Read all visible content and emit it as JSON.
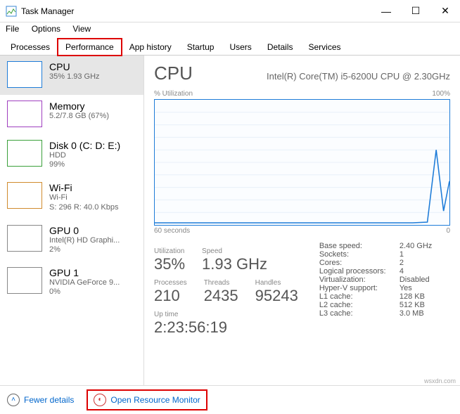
{
  "window": {
    "title": "Task Manager"
  },
  "menu": {
    "file": "File",
    "options": "Options",
    "view": "View"
  },
  "tabs": {
    "processes": "Processes",
    "performance": "Performance",
    "app_history": "App history",
    "startup": "Startup",
    "users": "Users",
    "details": "Details",
    "services": "Services"
  },
  "side": {
    "cpu": {
      "title": "CPU",
      "line1": "35%  1.93 GHz"
    },
    "mem": {
      "title": "Memory",
      "line1": "5.2/7.8 GB (67%)"
    },
    "disk": {
      "title": "Disk 0 (C: D: E:)",
      "line1": "HDD",
      "line2": "99%"
    },
    "wifi": {
      "title": "Wi-Fi",
      "line1": "Wi-Fi",
      "line2": "S: 296 R: 40.0 Kbps"
    },
    "gpu0": {
      "title": "GPU 0",
      "line1": "Intel(R) HD Graphi...",
      "line2": "2%"
    },
    "gpu1": {
      "title": "GPU 1",
      "line1": "NVIDIA GeForce 9...",
      "line2": "0%"
    }
  },
  "main": {
    "title": "CPU",
    "subtitle": "Intel(R) Core(TM) i5-6200U CPU @ 2.30GHz",
    "chart_top_left": "% Utilization",
    "chart_top_right": "100%",
    "chart_bot_left": "60 seconds",
    "chart_bot_right": "0",
    "stats": {
      "util_lbl": "Utilization",
      "util": "35%",
      "speed_lbl": "Speed",
      "speed": "1.93 GHz",
      "proc_lbl": "Processes",
      "proc": "210",
      "thr_lbl": "Threads",
      "thr": "2435",
      "hnd_lbl": "Handles",
      "hnd": "95243",
      "up_lbl": "Up time",
      "up": "2:23:56:19"
    },
    "kv": {
      "base": "Base speed:",
      "base_v": "2.40 GHz",
      "sock": "Sockets:",
      "sock_v": "1",
      "cores": "Cores:",
      "cores_v": "2",
      "lp": "Logical processors:",
      "lp_v": "4",
      "virt": "Virtualization:",
      "virt_v": "Disabled",
      "hv": "Hyper-V support:",
      "hv_v": "Yes",
      "l1": "L1 cache:",
      "l1_v": "128 KB",
      "l2": "L2 cache:",
      "l2_v": "512 KB",
      "l3": "L3 cache:",
      "l3_v": "3.0 MB"
    }
  },
  "footer": {
    "fewer": "Fewer details",
    "resmon": "Open Resource Monitor"
  },
  "watermark": "wsxdn.com",
  "chart_data": {
    "type": "line",
    "title": "% Utilization",
    "xlabel": "60 seconds",
    "ylabel": "% Utilization",
    "ylim": [
      0,
      100
    ],
    "x_seconds_ago": [
      60,
      55,
      50,
      45,
      40,
      35,
      30,
      25,
      20,
      15,
      10,
      5,
      3,
      1,
      0
    ],
    "values": [
      2,
      2,
      2,
      2,
      2,
      2,
      2,
      2,
      2,
      2,
      2,
      5,
      60,
      15,
      35
    ]
  }
}
